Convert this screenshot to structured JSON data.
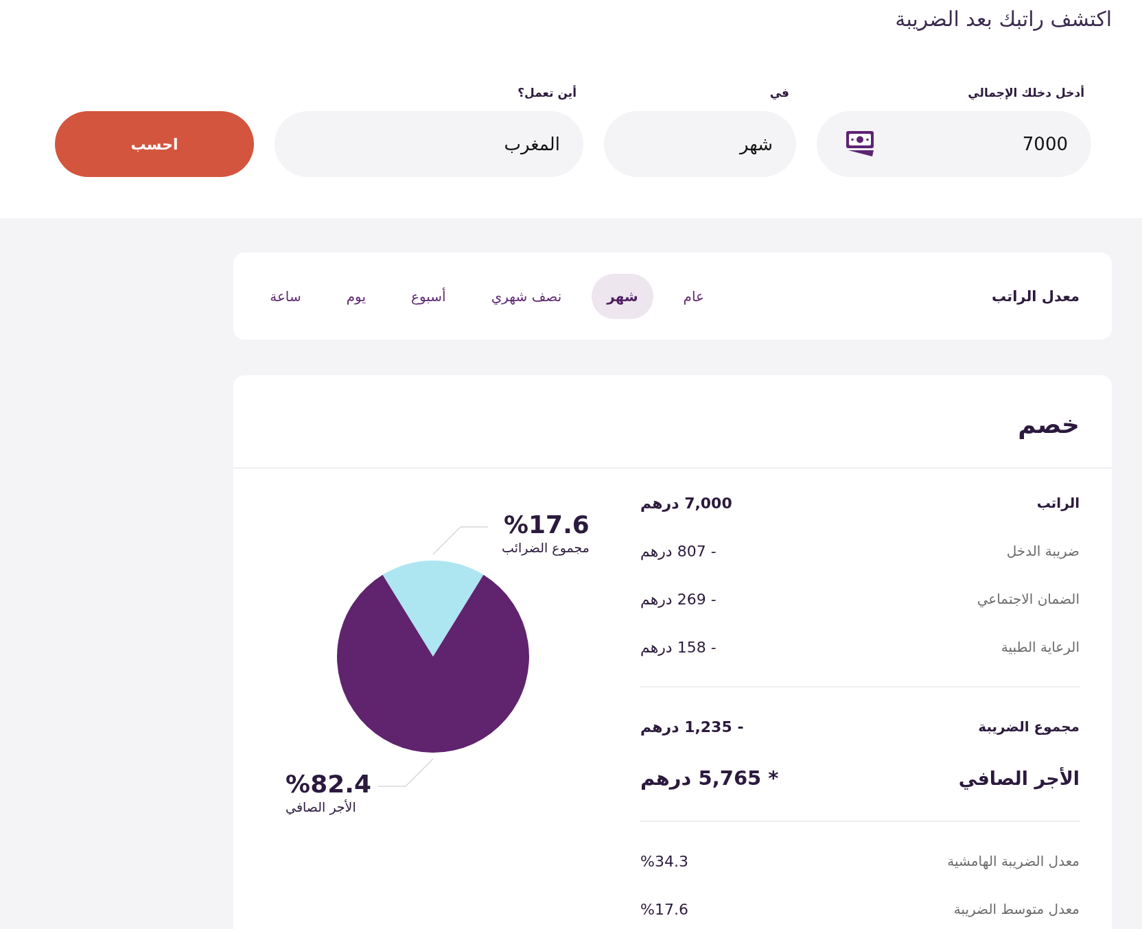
{
  "header": {
    "title": "اكتشف راتبك بعد الضريبة"
  },
  "form": {
    "fields": [
      {
        "label": "أدخل دخلك الإجمالي",
        "value": "7000",
        "kind": "money"
      },
      {
        "label": "في",
        "value": "شهر",
        "kind": "text"
      },
      {
        "label": "أين تعمل؟",
        "value": "المغرب",
        "kind": "text"
      }
    ],
    "button": "احسب"
  },
  "salary_rate": {
    "label": "معدل الراتب",
    "tabs": [
      {
        "label": "عام",
        "selected": false
      },
      {
        "label": "شهر",
        "selected": true
      },
      {
        "label": "نصف شهري",
        "selected": false
      },
      {
        "label": "أسبوع",
        "selected": false
      },
      {
        "label": "يوم",
        "selected": false
      },
      {
        "label": "ساعة",
        "selected": false
      }
    ]
  },
  "breakdown": {
    "title": "خصم",
    "sections": [
      {
        "rows": [
          {
            "label": "الراتب",
            "value": "7,000 درهم",
            "kind": "strong"
          },
          {
            "label": "ضريبة الدخل",
            "value": "- 807 درهم",
            "kind": "item"
          },
          {
            "label": "الضمان الاجتماعي",
            "value": "- 269 درهم",
            "kind": "item"
          },
          {
            "label": "الرعاية الطبية",
            "value": "- 158 درهم",
            "kind": "item"
          }
        ]
      },
      {
        "rows": [
          {
            "label": "مجموع الضريبة",
            "value": "- 1,235 درهم",
            "kind": "strong"
          },
          {
            "label": "الأجر الصافي",
            "value": "* 5,765 درهم",
            "kind": "net"
          }
        ]
      },
      {
        "rows": [
          {
            "label": "معدل الضريبة الهامشية",
            "value": "%34.3",
            "kind": "item"
          },
          {
            "label": "معدل متوسط الضريبة",
            "value": "%17.6",
            "kind": "item"
          }
        ]
      }
    ],
    "chart_data": {
      "type": "pie",
      "categories": [
        "مجموع الضرائب",
        "الأجر الصافي"
      ],
      "values": [
        17.6,
        82.4
      ],
      "value_labels": [
        "%17.6",
        "%82.4"
      ],
      "colors": [
        "#ade6f1",
        "#60236e"
      ]
    }
  }
}
